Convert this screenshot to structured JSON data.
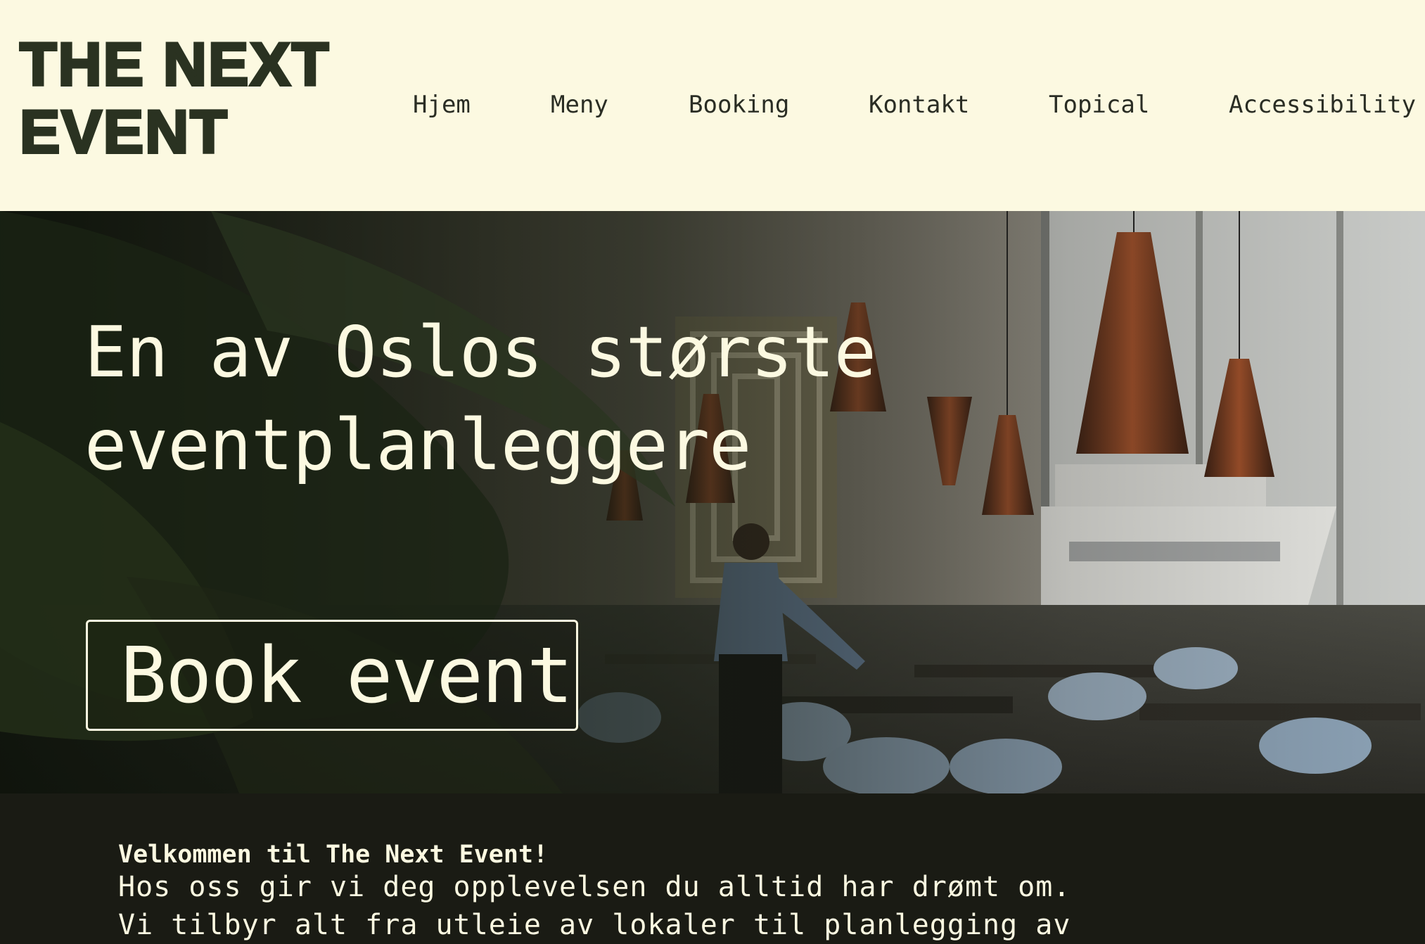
{
  "brand": {
    "line1": "THE NEXT",
    "line2": "EVENT"
  },
  "nav": {
    "items": [
      "Hjem",
      "Meny",
      "Booking",
      "Kontakt",
      "Topical",
      "Accessibility"
    ]
  },
  "hero": {
    "title_line1": "En av Oslos største",
    "title_line2": "eventplanleggere",
    "cta_label": "Book event"
  },
  "intro": {
    "heading": "Velkommen til The Next Event!",
    "line1": "Hos oss gir vi deg opplevelsen du alltid har drømt om.",
    "line2": "Vi tilbyr alt fra utleie av lokaler til planlegging av"
  },
  "colors": {
    "header_bg": "#fcf9e1",
    "logo": "#2a3221",
    "hero_text": "#fcf9e1",
    "dark_bg": "#1a1b14"
  }
}
